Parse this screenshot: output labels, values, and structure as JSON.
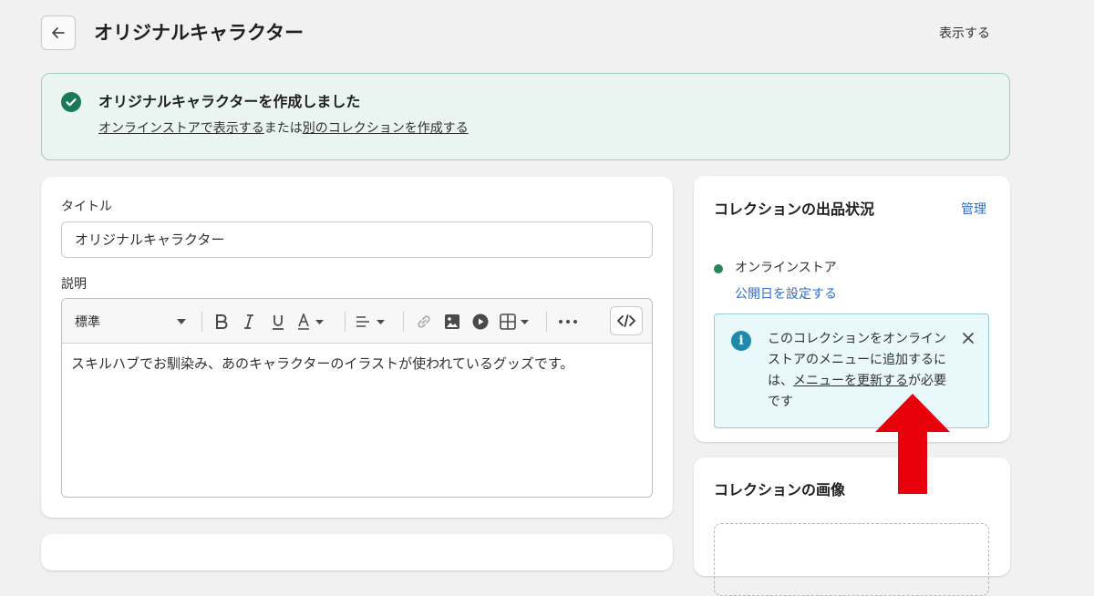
{
  "header": {
    "title": "オリジナルキャラクター",
    "view_label": "表示する"
  },
  "banner": {
    "title": "オリジナルキャラクターを作成しました",
    "link_view_store": "オンラインストアで表示する",
    "connector": "または",
    "link_create_collection": "別のコレクションを作成する",
    "accent_color": "#29845a"
  },
  "form": {
    "title_label": "タイトル",
    "title_value": "オリジナルキャラクター",
    "description_label": "説明",
    "toolbar": {
      "format_select": "標準",
      "icons": [
        "bold-icon",
        "italic-icon",
        "underline-icon",
        "text-color-icon",
        "align-icon",
        "link-icon",
        "image-icon",
        "video-icon",
        "table-icon",
        "more-icon",
        "code-icon"
      ]
    },
    "description_value": "スキルハブでお馴染み、あのキャラクターのイラストが使われているグッズです。"
  },
  "sidebar": {
    "availability": {
      "title": "コレクションの出品状況",
      "manage_label": "管理",
      "channel_name": "オンラインストア",
      "schedule_link": "公開日を設定する",
      "info": {
        "text_before": "このコレクションをオンラインストアのメニューに追加するには、",
        "link": "メニューを更新する",
        "text_after": "が必要です"
      }
    },
    "image": {
      "title": "コレクションの画像"
    }
  },
  "colors": {
    "link_blue": "#2c6ecb",
    "success_green": "#29845a",
    "annotation_red": "#e8000b"
  }
}
